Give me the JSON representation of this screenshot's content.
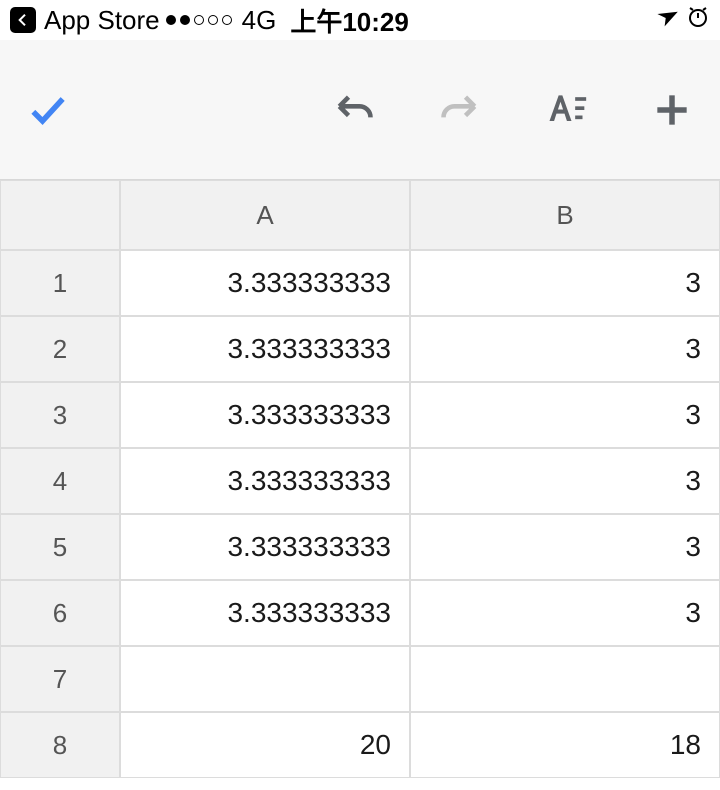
{
  "status_bar": {
    "back_label": "App Store",
    "signal_dots_filled": 2,
    "signal_dots_total": 5,
    "network": "4G",
    "time": "上午10:29"
  },
  "toolbar": {
    "confirm": "",
    "undo": "",
    "redo": "",
    "text_format": "",
    "add": ""
  },
  "sheet": {
    "columns": [
      "A",
      "B"
    ],
    "rows": [
      {
        "n": "1",
        "A": "3.333333333",
        "B": "3"
      },
      {
        "n": "2",
        "A": "3.333333333",
        "B": "3"
      },
      {
        "n": "3",
        "A": "3.333333333",
        "B": "3"
      },
      {
        "n": "4",
        "A": "3.333333333",
        "B": "3"
      },
      {
        "n": "5",
        "A": "3.333333333",
        "B": "3"
      },
      {
        "n": "6",
        "A": "3.333333333",
        "B": "3"
      },
      {
        "n": "7",
        "A": "",
        "B": ""
      },
      {
        "n": "8",
        "A": "20",
        "B": "18"
      }
    ]
  }
}
